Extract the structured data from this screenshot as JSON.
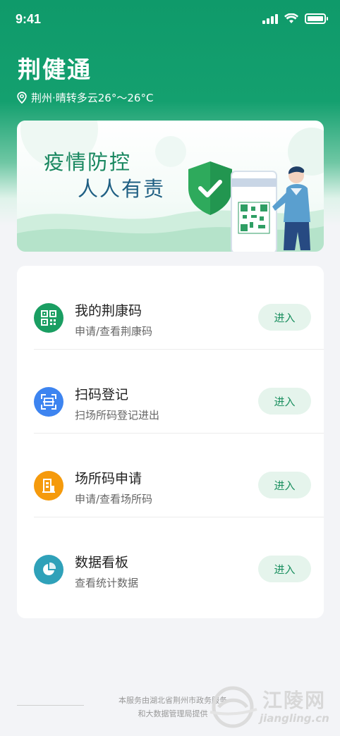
{
  "status_bar": {
    "time": "9:41"
  },
  "header": {
    "app_title": "荆健通",
    "location": "荆州·晴转多云26°～26°C"
  },
  "banner": {
    "line1": "疫情防控",
    "line2": "人人有责"
  },
  "services": [
    {
      "title": "我的荆康码",
      "subtitle": "申请/查看荆康码",
      "button": "进入",
      "icon": "qr-code-icon",
      "color": "#1a9e62"
    },
    {
      "title": "扫码登记",
      "subtitle": "扫场所码登记进出",
      "button": "进入",
      "icon": "scan-icon",
      "color": "#3d84f0"
    },
    {
      "title": "场所码申请",
      "subtitle": "申请/查看场所码",
      "button": "进入",
      "icon": "building-icon",
      "color": "#f59a0c"
    },
    {
      "title": "数据看板",
      "subtitle": "查看统计数据",
      "button": "进入",
      "icon": "pie-chart-icon",
      "color": "#2fa1b9"
    }
  ],
  "footer": {
    "line1": "本服务由湖北省荆州市政务服务",
    "line2": "和大数据管理局提供"
  },
  "watermark": {
    "text": "江陵网",
    "url": "jiangling.cn"
  }
}
